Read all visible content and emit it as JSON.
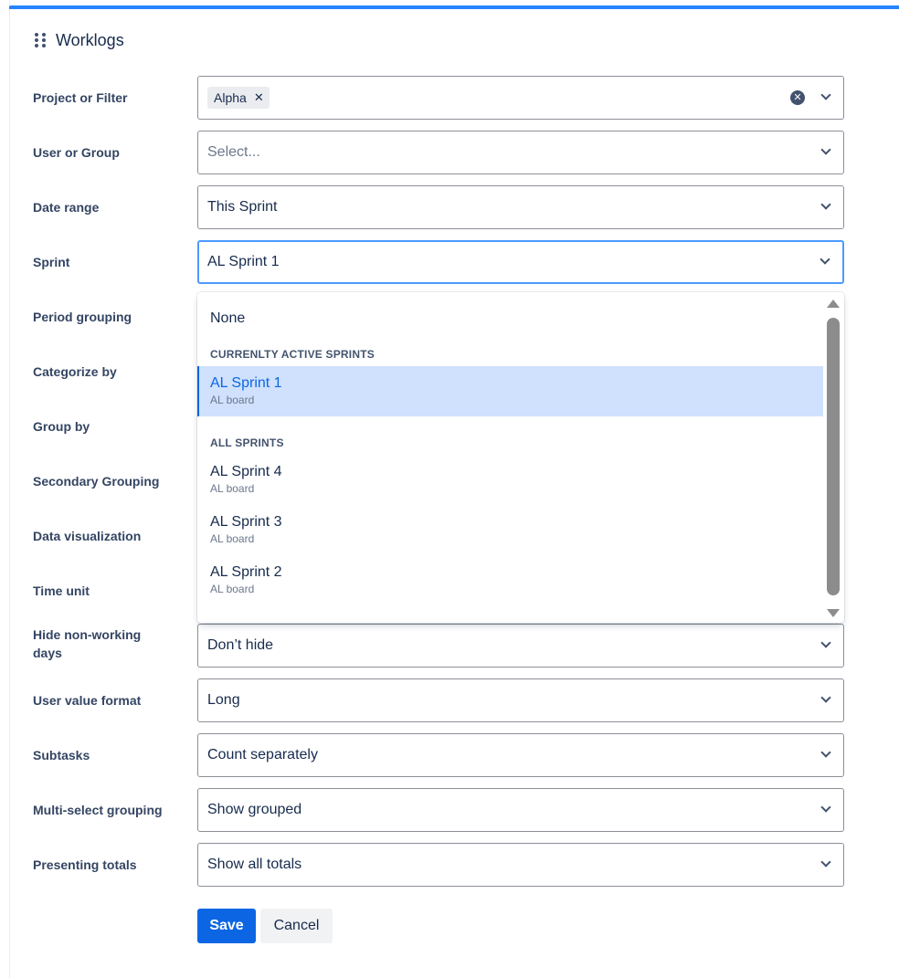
{
  "header": {
    "title": "Worklogs",
    "icon": "drag-handle-icon"
  },
  "fields": {
    "project": {
      "label": "Project or Filter",
      "tag": "Alpha"
    },
    "user": {
      "label": "User or Group",
      "placeholder": "Select..."
    },
    "date_range": {
      "label": "Date range",
      "value": "This Sprint"
    },
    "sprint": {
      "label": "Sprint",
      "value": "AL Sprint 1"
    },
    "period_grouping": {
      "label": "Period grouping"
    },
    "categorize_by": {
      "label": "Categorize by"
    },
    "group_by": {
      "label": "Group by"
    },
    "secondary_grouping": {
      "label": "Secondary Grouping"
    },
    "data_visualization": {
      "label": "Data visualization"
    },
    "time_unit": {
      "label": "Time unit"
    },
    "hide_non_working": {
      "label": "Hide non-working days",
      "value": "Don’t hide"
    },
    "user_value_format": {
      "label": "User value format",
      "value": "Long"
    },
    "subtasks": {
      "label": "Subtasks",
      "value": "Count separately"
    },
    "multi_select_grouping": {
      "label": "Multi-select grouping",
      "value": "Show grouped"
    },
    "presenting_totals": {
      "label": "Presenting totals",
      "value": "Show all totals"
    }
  },
  "sprint_dropdown": {
    "none_option": "None",
    "active_header": "CURRENLTY ACTIVE SPRINTS",
    "active": [
      {
        "name": "AL Sprint 1",
        "board": "AL board"
      }
    ],
    "all_header": "ALL SPRINTS",
    "all": [
      {
        "name": "AL Sprint 4",
        "board": "AL board"
      },
      {
        "name": "AL Sprint 3",
        "board": "AL board"
      },
      {
        "name": "AL Sprint 2",
        "board": "AL board"
      }
    ]
  },
  "actions": {
    "save": "Save",
    "cancel": "Cancel"
  },
  "colors": {
    "accent": "#0c66e4",
    "focus": "#4c9aff",
    "selected_bg": "#cfe1fd"
  }
}
